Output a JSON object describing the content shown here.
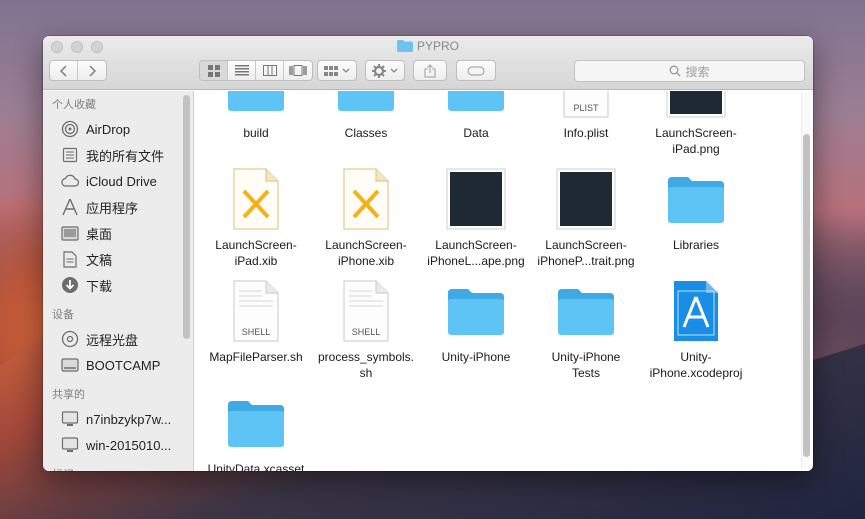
{
  "window": {
    "title": "PYPRO",
    "search_placeholder": "搜索"
  },
  "sidebar": {
    "favorites_header": "个人收藏",
    "favorites": [
      {
        "label": "AirDrop",
        "icon": "airdrop-icon"
      },
      {
        "label": "我的所有文件",
        "icon": "all-files-icon"
      },
      {
        "label": "iCloud Drive",
        "icon": "cloud-icon"
      },
      {
        "label": "应用程序",
        "icon": "applications-icon"
      },
      {
        "label": "桌面",
        "icon": "desktop-icon"
      },
      {
        "label": "文稿",
        "icon": "document-icon"
      },
      {
        "label": "下载",
        "icon": "download-icon"
      }
    ],
    "devices_header": "设备",
    "devices": [
      {
        "label": "远程光盘",
        "icon": "disc-icon"
      },
      {
        "label": "BOOTCAMP",
        "icon": "drive-icon"
      }
    ],
    "shared_header": "共享的",
    "shared": [
      {
        "label": "n7inbzykp7w...",
        "icon": "computer-icon"
      },
      {
        "label": "win-2015010...",
        "icon": "computer-icon"
      }
    ],
    "tags_header_partial": "标记"
  },
  "files": [
    {
      "name": [
        "build"
      ],
      "kind": "folder"
    },
    {
      "name": [
        "Classes"
      ],
      "kind": "folder"
    },
    {
      "name": [
        "Data"
      ],
      "kind": "folder"
    },
    {
      "name": [
        "Info.plist"
      ],
      "kind": "plist",
      "badge": "PLIST"
    },
    {
      "name": [
        "LaunchScreen-",
        "iPad.png"
      ],
      "kind": "image"
    },
    {
      "name": [
        "LaunchScreen-",
        "iPad.xib"
      ],
      "kind": "xib"
    },
    {
      "name": [
        "LaunchScreen-",
        "iPhone.xib"
      ],
      "kind": "xib"
    },
    {
      "name": [
        "LaunchScreen-",
        "iPhoneL...ape.png"
      ],
      "kind": "image"
    },
    {
      "name": [
        "LaunchScreen-",
        "iPhoneP...trait.png"
      ],
      "kind": "image"
    },
    {
      "name": [
        "Libraries"
      ],
      "kind": "folder"
    },
    {
      "name": [
        "MapFileParser.sh"
      ],
      "kind": "shell",
      "badge": "SHELL"
    },
    {
      "name": [
        "process_symbols.",
        "sh"
      ],
      "kind": "shell",
      "badge": "SHELL"
    },
    {
      "name": [
        "Unity-iPhone"
      ],
      "kind": "folder"
    },
    {
      "name": [
        "Unity-iPhone",
        "Tests"
      ],
      "kind": "folder"
    },
    {
      "name": [
        "Unity-",
        "iPhone.xcodeproj"
      ],
      "kind": "xcodeproj"
    },
    {
      "name": [
        "UnityData.xcasset"
      ],
      "kind": "folder"
    }
  ],
  "colors": {
    "folder_blue": "#5ec3f5",
    "folder_blue_dark": "#3fa9e6",
    "xib_orange": "#f3b21a",
    "xcode_blue": "#1a8ee6",
    "dark_image": "#1f2933"
  }
}
